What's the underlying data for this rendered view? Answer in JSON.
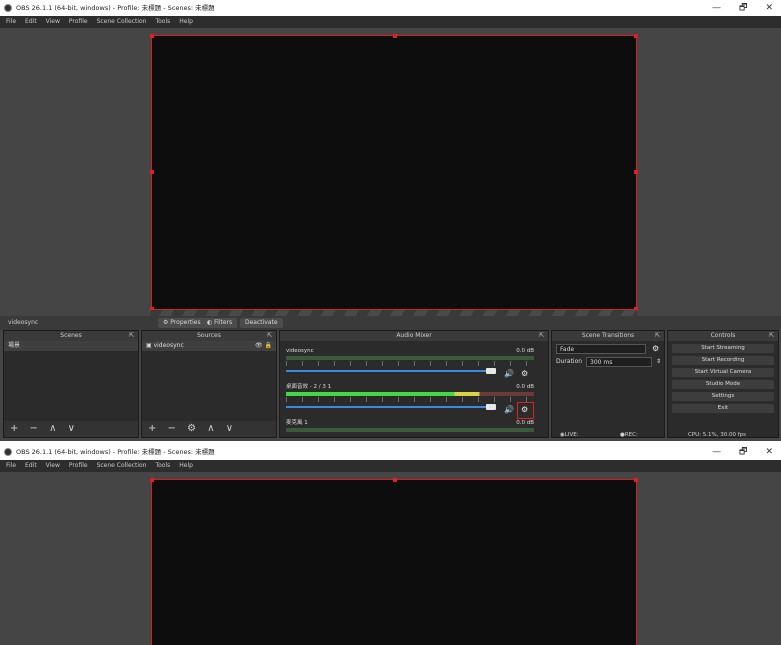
{
  "window": {
    "title": "OBS 26.1.1 (64-bit, windows) - Profile: 未標題 - Scenes: 未標題",
    "controls": {
      "minimize": "—",
      "maximize": "🗗",
      "close": "✕"
    }
  },
  "menu": [
    "File",
    "Edit",
    "View",
    "Profile",
    "Scene Collection",
    "Tools",
    "Help"
  ],
  "source_toolbar": {
    "current_source": "videosync",
    "properties": "Properties",
    "filters": "Filters",
    "deactivate": "Deactivate"
  },
  "scenes": {
    "header": "Scenes",
    "items": [
      "場景"
    ],
    "footer": "+ − ∧ ∨"
  },
  "sources": {
    "header": "Sources",
    "items": [
      "videosync"
    ],
    "footer": "+ − ⚙ ∧ ∨"
  },
  "audio_mixer": {
    "header": "Audio Mixer",
    "channels": [
      {
        "name": "videosync",
        "db": "0.0 dB"
      },
      {
        "name": "桌面音效 - 2 / 3 1",
        "db": "0.0 dB"
      },
      {
        "name": "麥克風 1",
        "db": "0.0 dB"
      }
    ]
  },
  "scene_transitions": {
    "header": "Scene Transitions",
    "transition": "Fade",
    "duration_label": "Duration",
    "duration_value": "300 ms"
  },
  "controls": {
    "header": "Controls",
    "buttons": [
      "Start Streaming",
      "Start Recording",
      "Start Virtual Camera",
      "Studio Mode",
      "Settings",
      "Exit"
    ]
  },
  "status": {
    "live": "LIVE: 00:00:00",
    "rec": "REC: 00:00:00",
    "cpu": "CPU: 5.1%, 30.00 fps"
  },
  "colors": {
    "accent_red": "#e02020",
    "fader_blue": "#3c89e0",
    "meter_green": "#45d845"
  }
}
